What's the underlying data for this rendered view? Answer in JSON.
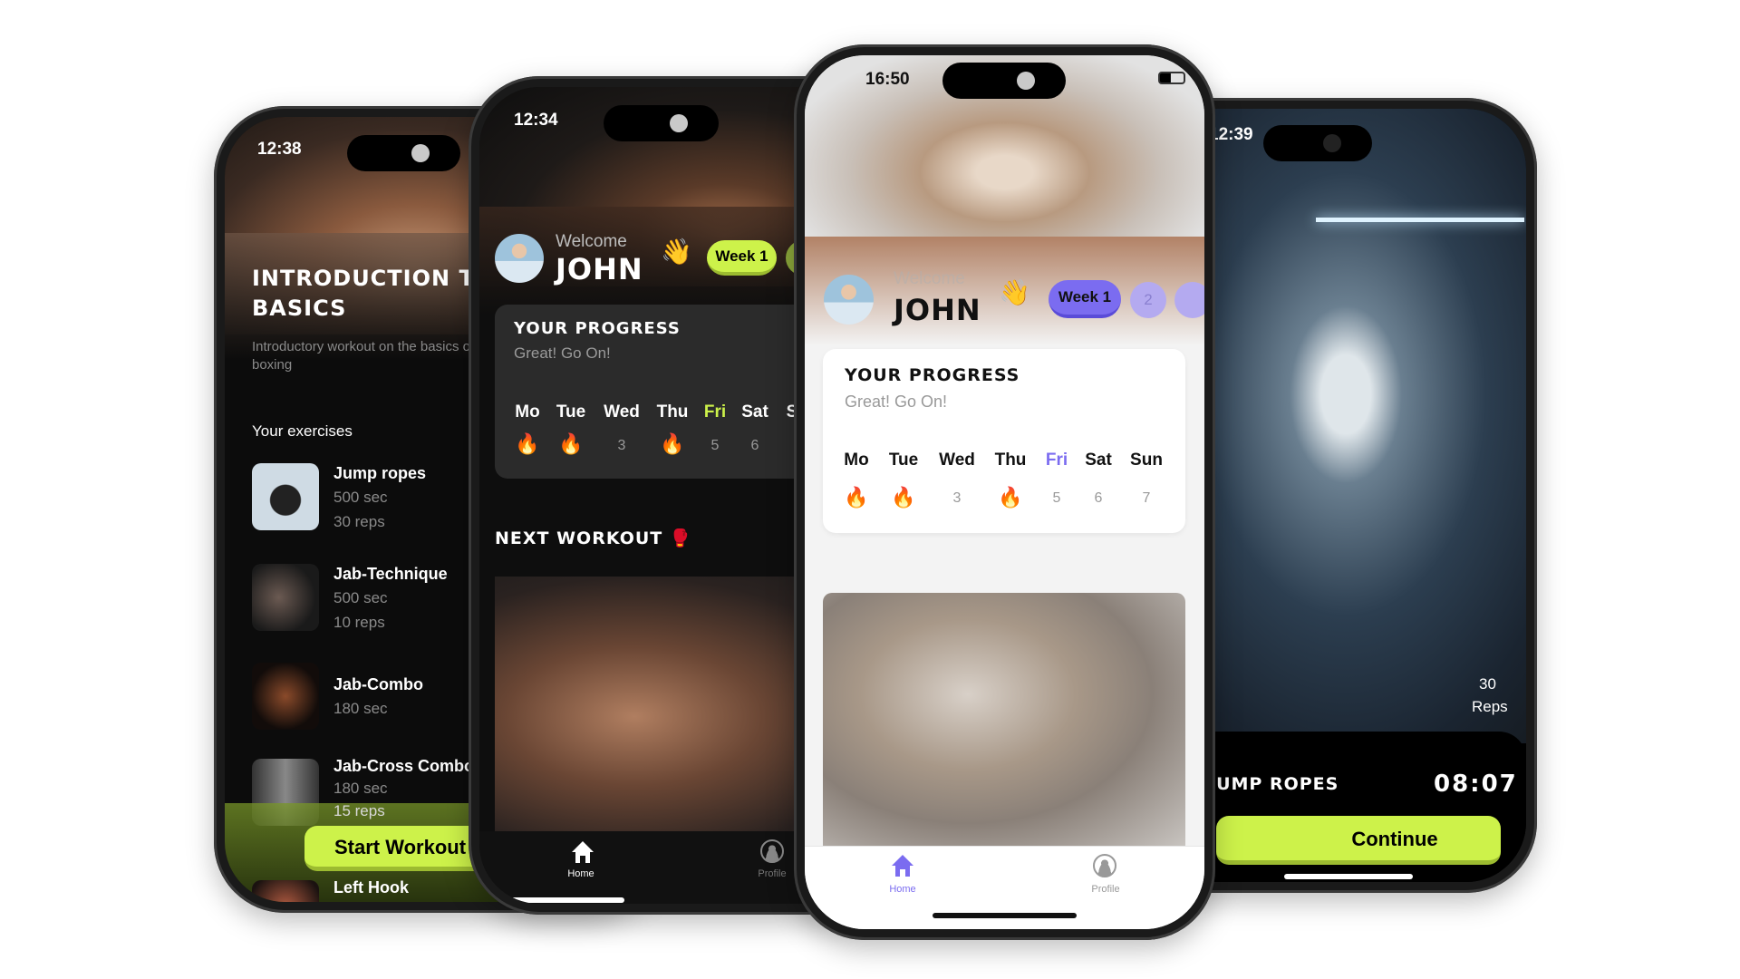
{
  "phone_exercises": {
    "status_time": "12:38",
    "title": "Introduction to basics",
    "description": "Introductory workout on the basics of boxing",
    "section_label": "Your exercises",
    "exercises": [
      {
        "name": "Jump ropes",
        "duration": "500 sec",
        "reps": "30 reps"
      },
      {
        "name": "Jab-Technique",
        "duration": "500 sec",
        "reps": "10 reps"
      },
      {
        "name": "Jab-Combo",
        "duration": "180 sec"
      },
      {
        "name": "Jab-Cross Combo",
        "duration": "180 sec",
        "reps": "15 reps"
      },
      {
        "name": "Left Hook"
      }
    ],
    "start_button": "Start Workout"
  },
  "phone_home_dark": {
    "status_time": "12:34",
    "welcome": "Welcome",
    "user_name": "JOHN",
    "week_pill": "Week 1",
    "progress_title": "YOUR PROGRESS",
    "progress_subtitle": "Great! Go On!",
    "days": [
      "Mo",
      "Tue",
      "Wed",
      "Thu",
      "Fri",
      "Sat",
      "S"
    ],
    "day_values": [
      "fire",
      "fire",
      "3",
      "fire",
      "5",
      "6"
    ],
    "next_workout": "NEXT WORKOUT",
    "nav": {
      "home": "Home",
      "profile": "Profile"
    },
    "accent": "#cdf24a"
  },
  "phone_home_light": {
    "status_time": "16:50",
    "welcome": "Welcome",
    "user_name": "JOHN",
    "week_pill": "Week 1",
    "week_2": "2",
    "progress_title": "YOUR PROGRESS",
    "progress_subtitle": "Great! Go On!",
    "days": [
      "Mo",
      "Tue",
      "Wed",
      "Thu",
      "Fri",
      "Sat",
      "Sun"
    ],
    "day_values": [
      "fire",
      "fire",
      "3",
      "fire",
      "5",
      "6",
      "7"
    ],
    "nav": {
      "home": "Home",
      "profile": "Profile"
    },
    "accent": "#7b6cf0"
  },
  "phone_timer": {
    "status_time": "12:39",
    "reps_count": "30",
    "reps_label": "Reps",
    "exercise_name": "JUMP ROPES",
    "timer": "08:07",
    "continue_button": "Continue",
    "accent": "#cdf24a"
  }
}
